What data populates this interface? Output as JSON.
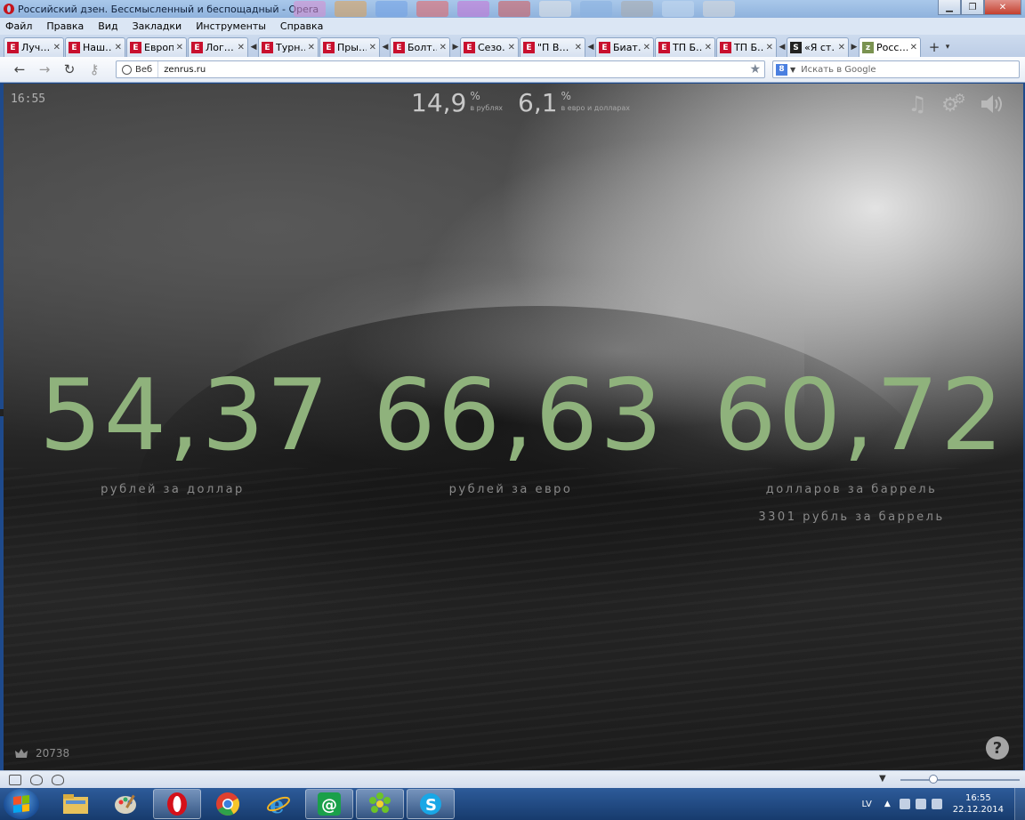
{
  "window": {
    "title": "Российский дзен. Бессмысленный и беспощадный - Opera"
  },
  "menu": [
    "Файл",
    "Правка",
    "Вид",
    "Закладки",
    "Инструменты",
    "Справка"
  ],
  "tabs": [
    {
      "label": "Луч…",
      "favicon": "E"
    },
    {
      "label": "Наш…",
      "favicon": "E"
    },
    {
      "label": "Eвроп…",
      "favicon": "E"
    },
    {
      "label": "Лог…",
      "favicon": "E"
    },
    {
      "label": "Турн…",
      "favicon": "E"
    },
    {
      "label": "Пры…",
      "favicon": "E"
    },
    {
      "label": "Болт…",
      "favicon": "E"
    },
    {
      "label": "Сезо…",
      "favicon": "E"
    },
    {
      "label": "\"П В…",
      "favicon": "E"
    },
    {
      "label": "Биат…",
      "favicon": "E"
    },
    {
      "label": "ТП Б…",
      "favicon": "E"
    },
    {
      "label": "ТП Б…",
      "favicon": "E"
    },
    {
      "label": "«Я ст…",
      "favicon": "S"
    },
    {
      "label": "Росс…",
      "favicon": "z"
    }
  ],
  "address": {
    "web_label": "Веб",
    "url": "zenrus.ru",
    "search_placeholder": "Искать в Google",
    "search_engine_letter": "8"
  },
  "page": {
    "time": "16:55",
    "inflation": [
      {
        "value": "14,9",
        "unit": "%",
        "label": "в рублях"
      },
      {
        "value": "6,1",
        "unit": "%",
        "label": "в евро и долларах"
      }
    ],
    "rates": [
      {
        "value": "54,37",
        "label": "рублей за доллар"
      },
      {
        "value": "66,63",
        "label": "рублей за евро"
      },
      {
        "value": "60,72",
        "label": "долларов за баррель",
        "sub": "3301 рубль за баррель"
      }
    ],
    "counter": "20738",
    "accent_color": "#8fb27c",
    "icons": [
      "music-icon",
      "gears-icon",
      "speaker-icon",
      "crown-icon",
      "help-icon"
    ]
  },
  "taskbar": {
    "lang": "LV",
    "clock_time": "16:55",
    "clock_date": "22.12.2014",
    "apps": [
      "explorer",
      "paint",
      "opera",
      "chrome",
      "internet-explorer",
      "mail-agent",
      "icq",
      "skype"
    ]
  }
}
